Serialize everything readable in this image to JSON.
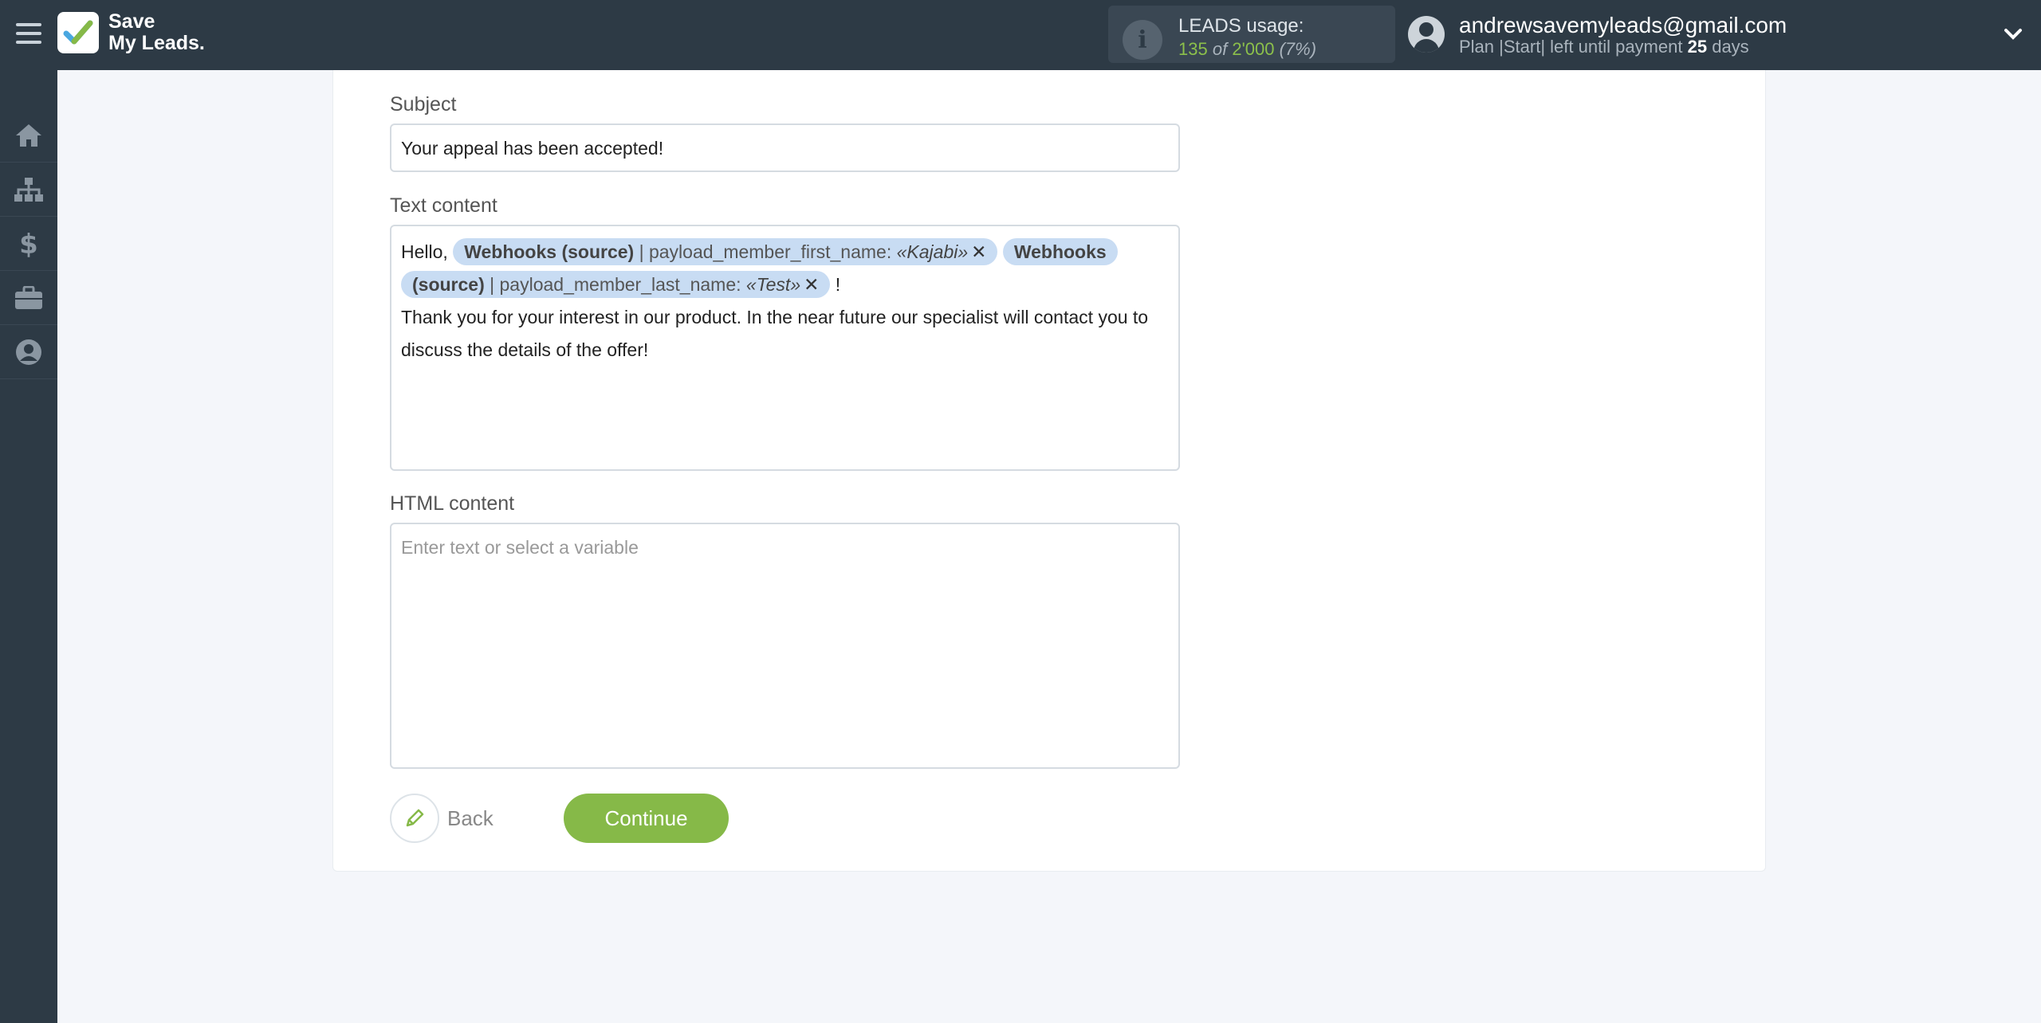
{
  "header": {
    "logo_line1": "Save",
    "logo_line2": "My Leads.",
    "usage_title": "LEADS usage:",
    "usage_used": "135",
    "usage_of": "of",
    "usage_total": "2'000",
    "usage_percent": "(7%)",
    "account_email": "andrewsavemyleads@gmail.com",
    "plan_prefix": "Plan |Start| left until payment",
    "plan_days": "25",
    "plan_suffix": "days"
  },
  "sidebar": {
    "items": [
      {
        "icon": "home-icon"
      },
      {
        "icon": "sitemap-icon"
      },
      {
        "icon": "dollar-icon"
      },
      {
        "icon": "briefcase-icon"
      },
      {
        "icon": "user-circle-icon"
      }
    ]
  },
  "form": {
    "subject_label": "Subject",
    "subject_value": "Your appeal has been accepted!",
    "text_label": "Text content",
    "text_hello": "Hello,",
    "chip1_source": "Webhooks (source)",
    "chip1_field": "| payload_member_first_name:",
    "chip1_value": "«Kajabi»",
    "chip2_source_part1": "Webhooks",
    "chip2_source_part2": "(source)",
    "chip2_field": "| payload_member_last_name:",
    "chip2_value": "«Test»",
    "text_exclaim": "!",
    "text_body_line1": "Thank you for your interest in our product. In the near future our specialist will contact you to",
    "text_body_line2": "discuss the details of the offer!",
    "html_label": "HTML content",
    "html_placeholder": "Enter text or select a variable"
  },
  "actions": {
    "back_label": "Back",
    "continue_label": "Continue"
  },
  "colors": {
    "topbar": "#2d3a45",
    "accent_green": "#86b948",
    "chip_bg": "#c8dcf3"
  }
}
